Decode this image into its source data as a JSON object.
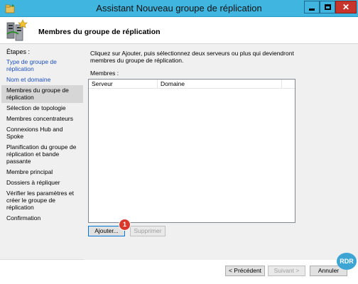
{
  "window": {
    "title": "Assistant Nouveau groupe de réplication"
  },
  "header": {
    "title": "Membres du groupe de réplication"
  },
  "steps": {
    "title": "Étapes :",
    "items": [
      {
        "label": "Type de groupe de réplication",
        "state": "done"
      },
      {
        "label": "Nom et domaine",
        "state": "done"
      },
      {
        "label": "Membres du groupe de réplication",
        "state": "active"
      },
      {
        "label": "Sélection de topologie",
        "state": "pending"
      },
      {
        "label": "Membres concentrateurs",
        "state": "pending"
      },
      {
        "label": "Connexions Hub and Spoke",
        "state": "pending"
      },
      {
        "label": "Planification du groupe de réplication et bande passante",
        "state": "pending"
      },
      {
        "label": "Membre principal",
        "state": "pending"
      },
      {
        "label": "Dossiers à répliquer",
        "state": "pending"
      },
      {
        "label": "Vérifier les paramètres et créer le groupe de réplication",
        "state": "pending"
      },
      {
        "label": "Confirmation",
        "state": "pending"
      }
    ]
  },
  "main": {
    "instruction": "Cliquez sur Ajouter, puis sélectionnez deux serveurs ou plus qui deviendront membres du groupe de réplication.",
    "members_label": "Membres :",
    "columns": [
      "Serveur",
      "Domaine"
    ],
    "rows": [],
    "add_label": "Ajouter...",
    "remove_label": "Supprimer",
    "badge": "1"
  },
  "footer": {
    "prev_label": "< Précédent",
    "next_label": "Suivant >",
    "cancel_label": "Annuler"
  },
  "watermark": "RDR",
  "colors": {
    "titlebar": "#3fb5df",
    "close_button": "#c7342b",
    "link_blue": "#1c4fbc",
    "badge_red": "#d9382c"
  }
}
